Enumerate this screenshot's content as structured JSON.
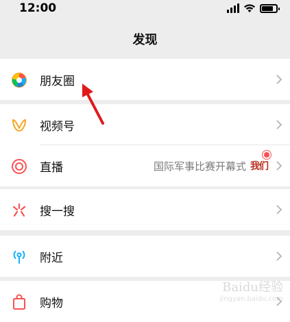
{
  "status_bar": {
    "time": "12:00"
  },
  "nav": {
    "title": "发现"
  },
  "items": {
    "moments": {
      "label": "朋友圈"
    },
    "channels": {
      "label": "视频号"
    },
    "live": {
      "label": "直播",
      "subtitle": "国际军事比赛开幕式",
      "badge": "我们"
    },
    "shake": {
      "label": "搜一搜"
    },
    "nearby": {
      "label": "附近"
    },
    "shopping": {
      "label": "购物"
    }
  },
  "watermark": {
    "main": "Baidu经验",
    "sub": "jingyan.baidu.com"
  },
  "colors": {
    "background": "#ededed",
    "cell": "#ffffff",
    "arrow": "#e0191b",
    "live_dot": "#fa5151"
  }
}
